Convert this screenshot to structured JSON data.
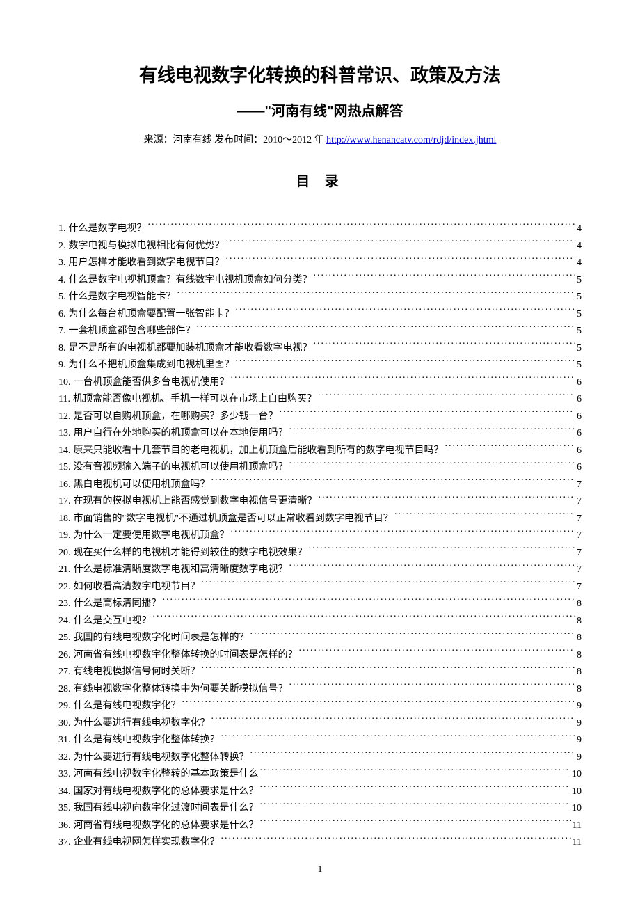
{
  "title": "有线电视数字化转换的科普常识、政策及方法",
  "subtitle": "——\"河南有线\"网热点解答",
  "source_prefix": "来源：河南有线 发布时间：2010～2012 年   ",
  "source_link": "http://www.henancatv.com/rdjd/index.jhtml",
  "toc_heading": "目  录",
  "page_number": "1",
  "toc": [
    {
      "num": "1.",
      "text": "什么是数字电视？",
      "page": "4"
    },
    {
      "num": "2.",
      "text": "数字电视与模拟电视相比有何优势？",
      "page": "4"
    },
    {
      "num": "3.",
      "text": "用户怎样才能收看到数字电视节目？",
      "page": "4"
    },
    {
      "num": "4.",
      "text": "什么是数字电视机顶盒？有线数字电视机顶盒如何分类？",
      "page": "5"
    },
    {
      "num": "5.",
      "text": "什么是数字电视智能卡？",
      "page": "5"
    },
    {
      "num": "6.",
      "text": "为什么每台机顶盒要配置一张智能卡？",
      "page": "5"
    },
    {
      "num": "7.",
      "text": "一套机顶盒都包含哪些部件？",
      "page": "5"
    },
    {
      "num": "8.",
      "text": "是不是所有的电视机都要加装机顶盒才能收看数字电视？",
      "page": "5"
    },
    {
      "num": "9.",
      "text": "为什么不把机顶盒集成到电视机里面？",
      "page": "5"
    },
    {
      "num": "10.",
      "text": "一台机顶盒能否供多台电视机使用？",
      "page": "6"
    },
    {
      "num": "11.",
      "text": "机顶盒能否像电视机、手机一样可以在市场上自由购买？",
      "page": "6"
    },
    {
      "num": "12.",
      "text": "是否可以自购机顶盒，在哪购买？多少钱一台？",
      "page": "6"
    },
    {
      "num": "13.",
      "text": "用户自行在外地购买的机顶盒可以在本地使用吗？",
      "page": "6"
    },
    {
      "num": "14.",
      "text": "原来只能收看十几套节目的老电视机，加上机顶盒后能收看到所有的数字电视节目吗？",
      "page": "6"
    },
    {
      "num": "15.",
      "text": "没有音视频输入端子的电视机可以使用机顶盒吗？",
      "page": "6"
    },
    {
      "num": "16.",
      "text": "黑白电视机可以使用机顶盒吗？",
      "page": "7"
    },
    {
      "num": "17.",
      "text": "在现有的模拟电视机上能否感觉到数字电视信号更清晰？",
      "page": "7"
    },
    {
      "num": "18.",
      "text": "市面销售的\"数字电视机\"不通过机顶盒是否可以正常收看到数字电视节目？",
      "page": "7"
    },
    {
      "num": "19.",
      "text": "为什么一定要使用数字电视机顶盒？",
      "page": "7"
    },
    {
      "num": "20.",
      "text": "现在买什么样的电视机才能得到较佳的数字电视效果？",
      "page": "7"
    },
    {
      "num": "21.",
      "text": "什么是标准清晰度数字电视和高清晰度数字电视？",
      "page": "7"
    },
    {
      "num": "22.",
      "text": "如何收看高清数字电视节目？",
      "page": "7"
    },
    {
      "num": "23.",
      "text": "什么是高标清同播？",
      "page": "8"
    },
    {
      "num": "24.",
      "text": "什么是交互电视？",
      "page": "8"
    },
    {
      "num": "25.",
      "text": "我国的有线电视数字化时间表是怎样的？",
      "page": "8"
    },
    {
      "num": "26.",
      "text": "河南省有线电视数字化整体转换的时间表是怎样的？",
      "page": "8"
    },
    {
      "num": "27.",
      "text": "有线电视模拟信号何时关断？",
      "page": "8"
    },
    {
      "num": "28.",
      "text": "有线电视数字化整体转换中为何要关断模拟信号？",
      "page": "8"
    },
    {
      "num": "29.",
      "text": "什么是有线电视数字化？",
      "page": "9"
    },
    {
      "num": "30.",
      "text": "为什么要进行有线电视数字化？",
      "page": "9"
    },
    {
      "num": "31.",
      "text": "什么是有线电视数字化整体转换？",
      "page": "9"
    },
    {
      "num": "32.",
      "text": "为什么要进行有线电视数字化整体转换？",
      "page": "9"
    },
    {
      "num": "33.",
      "text": "河南有线电视数字化整转的基本政策是什么",
      "page": "10"
    },
    {
      "num": "34.",
      "text": "国家对有线电视数字化的总体要求是什么？",
      "page": "10"
    },
    {
      "num": "35.",
      "text": "我国有线电视向数字化过渡时间表是什么？",
      "page": "10"
    },
    {
      "num": "36.",
      "text": "河南省有线电视数字化的总体要求是什么？",
      "page": "11"
    },
    {
      "num": "37.",
      "text": "企业有线电视网怎样实现数字化？",
      "page": "11"
    }
  ]
}
